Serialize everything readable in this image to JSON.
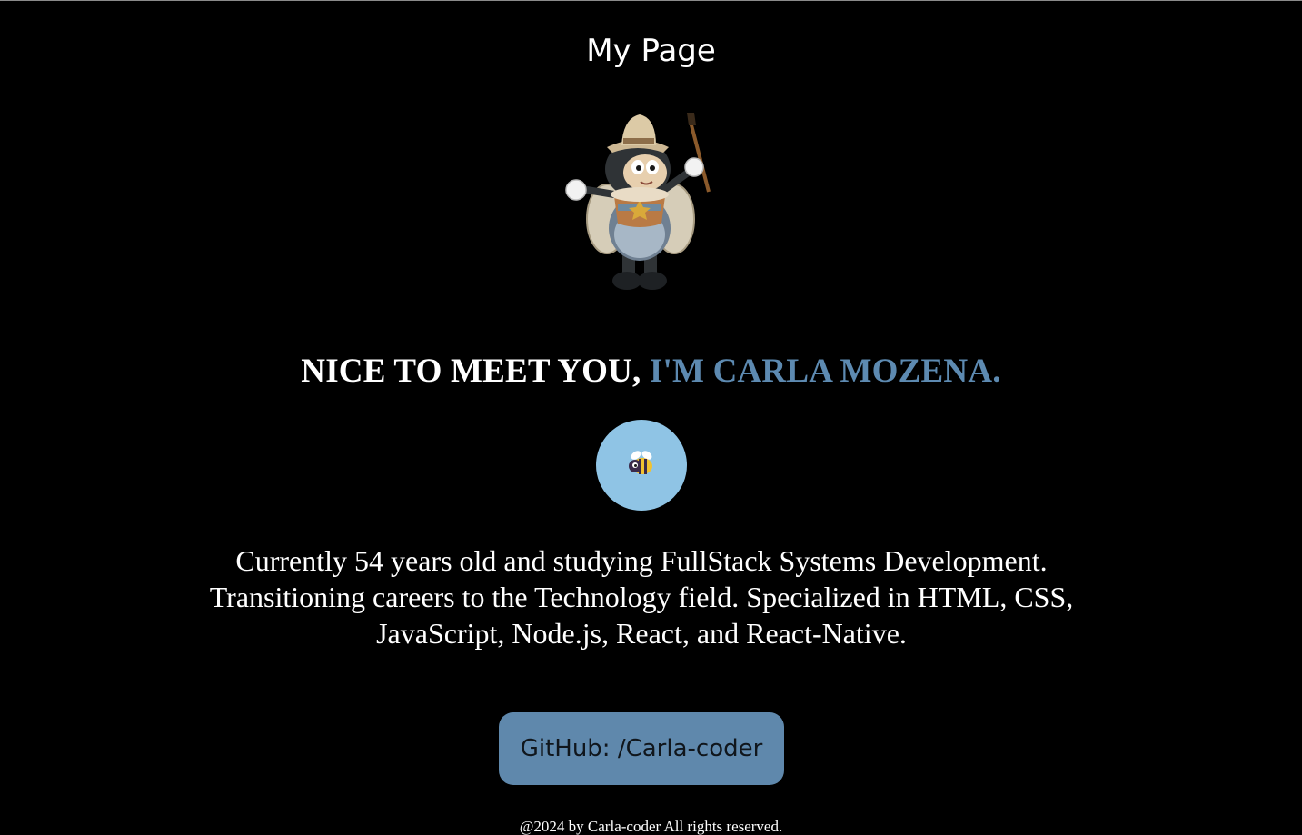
{
  "header": {
    "title": "My Page"
  },
  "greeting": {
    "prefix": "NICE TO MEET YOU,",
    "name": "I'M CARLA MOZENA."
  },
  "bio": {
    "text": "Currently 54 years old and studying FullStack Systems Development. Transitioning careers to the Technology field. Specialized in HTML, CSS, JavaScript, Node.js, React, and React-Native."
  },
  "github": {
    "label": "GitHub: /Carla-coder"
  },
  "footer": {
    "text": "@2024 by Carla-coder All rights reserved."
  },
  "colors": {
    "background": "#000000",
    "accent": "#5d8ab1",
    "avatar_bg": "#8fc4e5",
    "button_bg": "#5f88ac"
  },
  "icons": {
    "mascot": "bee-painter-illustration",
    "avatar": "bee-icon"
  }
}
